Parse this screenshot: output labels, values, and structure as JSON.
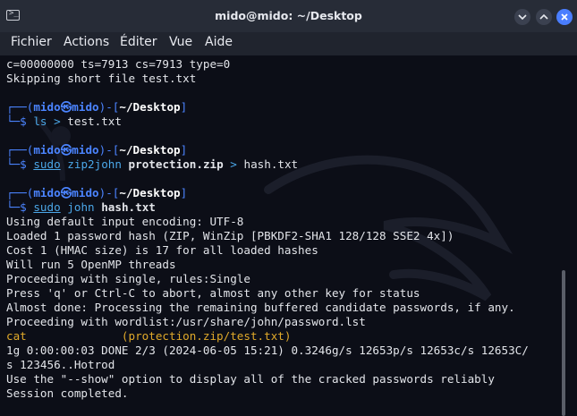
{
  "window": {
    "title": "mido@mido: ~/Desktop"
  },
  "menu": [
    "Fichier",
    "Actions",
    "Éditer",
    "Vue",
    "Aide"
  ],
  "prompt": {
    "open": "┌──(",
    "user": "mido",
    "sep": "㉿",
    "host": "mido",
    "close": ")-[",
    "path": "~/Desktop",
    "end": "]",
    "arrow": "└─$"
  },
  "terminal": {
    "l1": "c=00000000 ts=7913 cs=7913 type=0",
    "l2": "Skipping short file test.txt",
    "c1": {
      "cmd": "ls",
      "op": ">",
      "arg": "test.txt"
    },
    "c2": {
      "sudo": "sudo",
      "cmd": "zip2john",
      "file": "protection.zip",
      "op": ">",
      "out": "hash.txt"
    },
    "c3": {
      "sudo": "sudo",
      "cmd": "john",
      "file": "hash.txt"
    },
    "out": [
      "Using default input encoding: UTF-8",
      "Loaded 1 password hash (ZIP, WinZip [PBKDF2-SHA1 128/128 SSE2 4x])",
      "Cost 1 (HMAC size) is 17 for all loaded hashes",
      "Will run 5 OpenMP threads",
      "Proceeding with single, rules:Single",
      "Press 'q' or Ctrl-C to abort, almost any other key for status",
      "Almost done: Processing the remaining buffered candidate passwords, if any.",
      "Proceeding with wordlist:/usr/share/john/password.lst"
    ],
    "found_pw": "cat",
    "found_file": "(protection.zip/test.txt)",
    "stat1": "1g 0:00:00:03 DONE 2/3 (2024-06-05 15:21) 0.3246g/s 12653p/s 12653c/s 12653C/",
    "stat2": "s 123456..Hotrod",
    "hint": "Use the \"--show\" option to display all of the cracked passwords reliably",
    "done": "Session completed."
  }
}
